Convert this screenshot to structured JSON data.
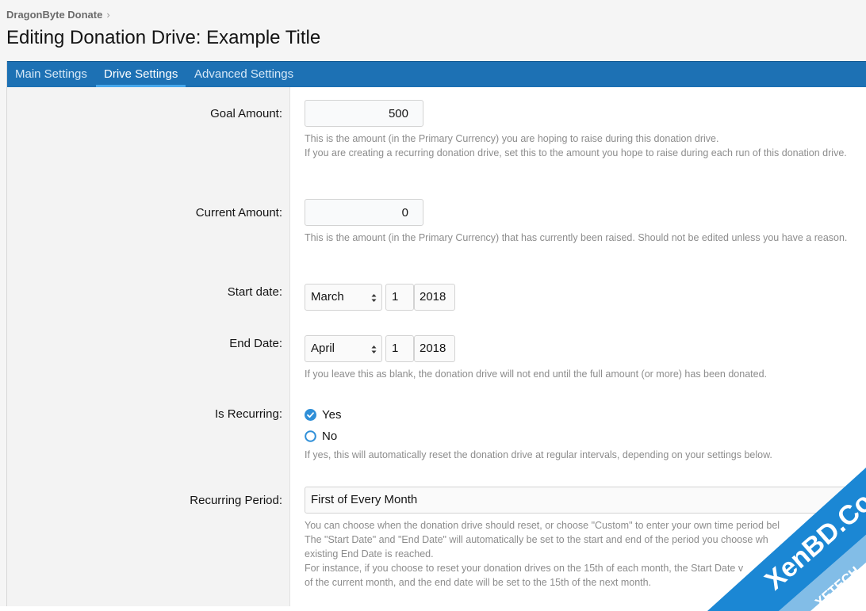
{
  "breadcrumb": {
    "item": "DragonByte Donate",
    "separator": "›"
  },
  "page": {
    "title": "Editing Donation Drive: Example Title"
  },
  "tabs": [
    {
      "label": "Main Settings",
      "active": false
    },
    {
      "label": "Drive Settings",
      "active": true
    },
    {
      "label": "Advanced Settings",
      "active": false
    }
  ],
  "goal_amount": {
    "label": "Goal Amount:",
    "value": "500",
    "hint_1": "This is the amount (in the Primary Currency) you are hoping to raise during this donation drive.",
    "hint_2": "If you are creating a recurring donation drive, set this to the amount you hope to raise during each run of this donation drive."
  },
  "current_amount": {
    "label": "Current Amount:",
    "value": "0",
    "hint": "This is the amount (in the Primary Currency) that has currently been raised. Should not be edited unless you have a reason."
  },
  "start_date": {
    "label": "Start date:",
    "month": "March",
    "day": "1",
    "year": "2018"
  },
  "end_date": {
    "label": "End Date:",
    "month": "April",
    "day": "1",
    "year": "2018",
    "hint": "If you leave this as blank, the donation drive will not end until the full amount (or more) has been donated."
  },
  "is_recurring": {
    "label": "Is Recurring:",
    "option_yes": "Yes",
    "option_no": "No",
    "selected": "Yes",
    "hint": "If yes, this will automatically reset the donation drive at regular intervals, depending on your settings below."
  },
  "recurring_period": {
    "label": "Recurring Period:",
    "value": "First of Every Month",
    "hint_1": "You can choose when the donation drive should reset, or choose \"Custom\" to enter your own time period bel",
    "hint_2": "The \"Start Date\" and \"End Date\" will automatically be set to the start and end of the period you choose wh",
    "hint_3": "existing End Date is reached.",
    "hint_4": "For instance, if you choose to reset your donation drives on the 15th of each month, the Start Date v",
    "hint_5": "of the current month, and the end date will be set to the 15th of the next month."
  },
  "watermark": {
    "line_1": "XenBD.Com",
    "line_2": "XFTECH"
  },
  "colors": {
    "tab_bar": "#1d71b4",
    "tab_active_underline": "#47a7eb",
    "radio_checked": "#2f8fd8",
    "watermark_band": "#1b87d4"
  }
}
